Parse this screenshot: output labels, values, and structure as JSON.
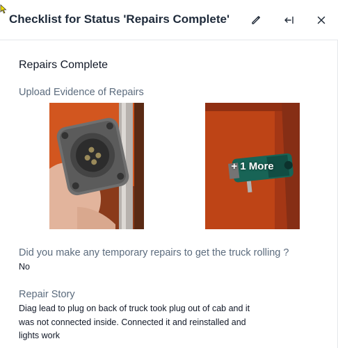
{
  "header": {
    "title": "Checklist for Status 'Repairs Complete'",
    "icons": [
      "edit-pencil-icon",
      "collapse-left-icon",
      "close-icon"
    ]
  },
  "section": {
    "title": "Repairs Complete"
  },
  "upload": {
    "label": "Upload Evidence of Repairs",
    "more_label": "+ 1 More"
  },
  "question": {
    "label": "Did you make any temporary repairs to get the truck rolling ?",
    "answer": "No"
  },
  "story": {
    "label": "Repair Story",
    "lines": [
      "Diag lead to plug on back of truck took plug out of cab and it",
      "was not connected inside. Connected it and reinstalled and",
      "lights work"
    ]
  },
  "colors": {
    "accent_orange": "#e8531c",
    "label_gray": "#5b6b7d",
    "title_dark": "#1e2a3a"
  }
}
